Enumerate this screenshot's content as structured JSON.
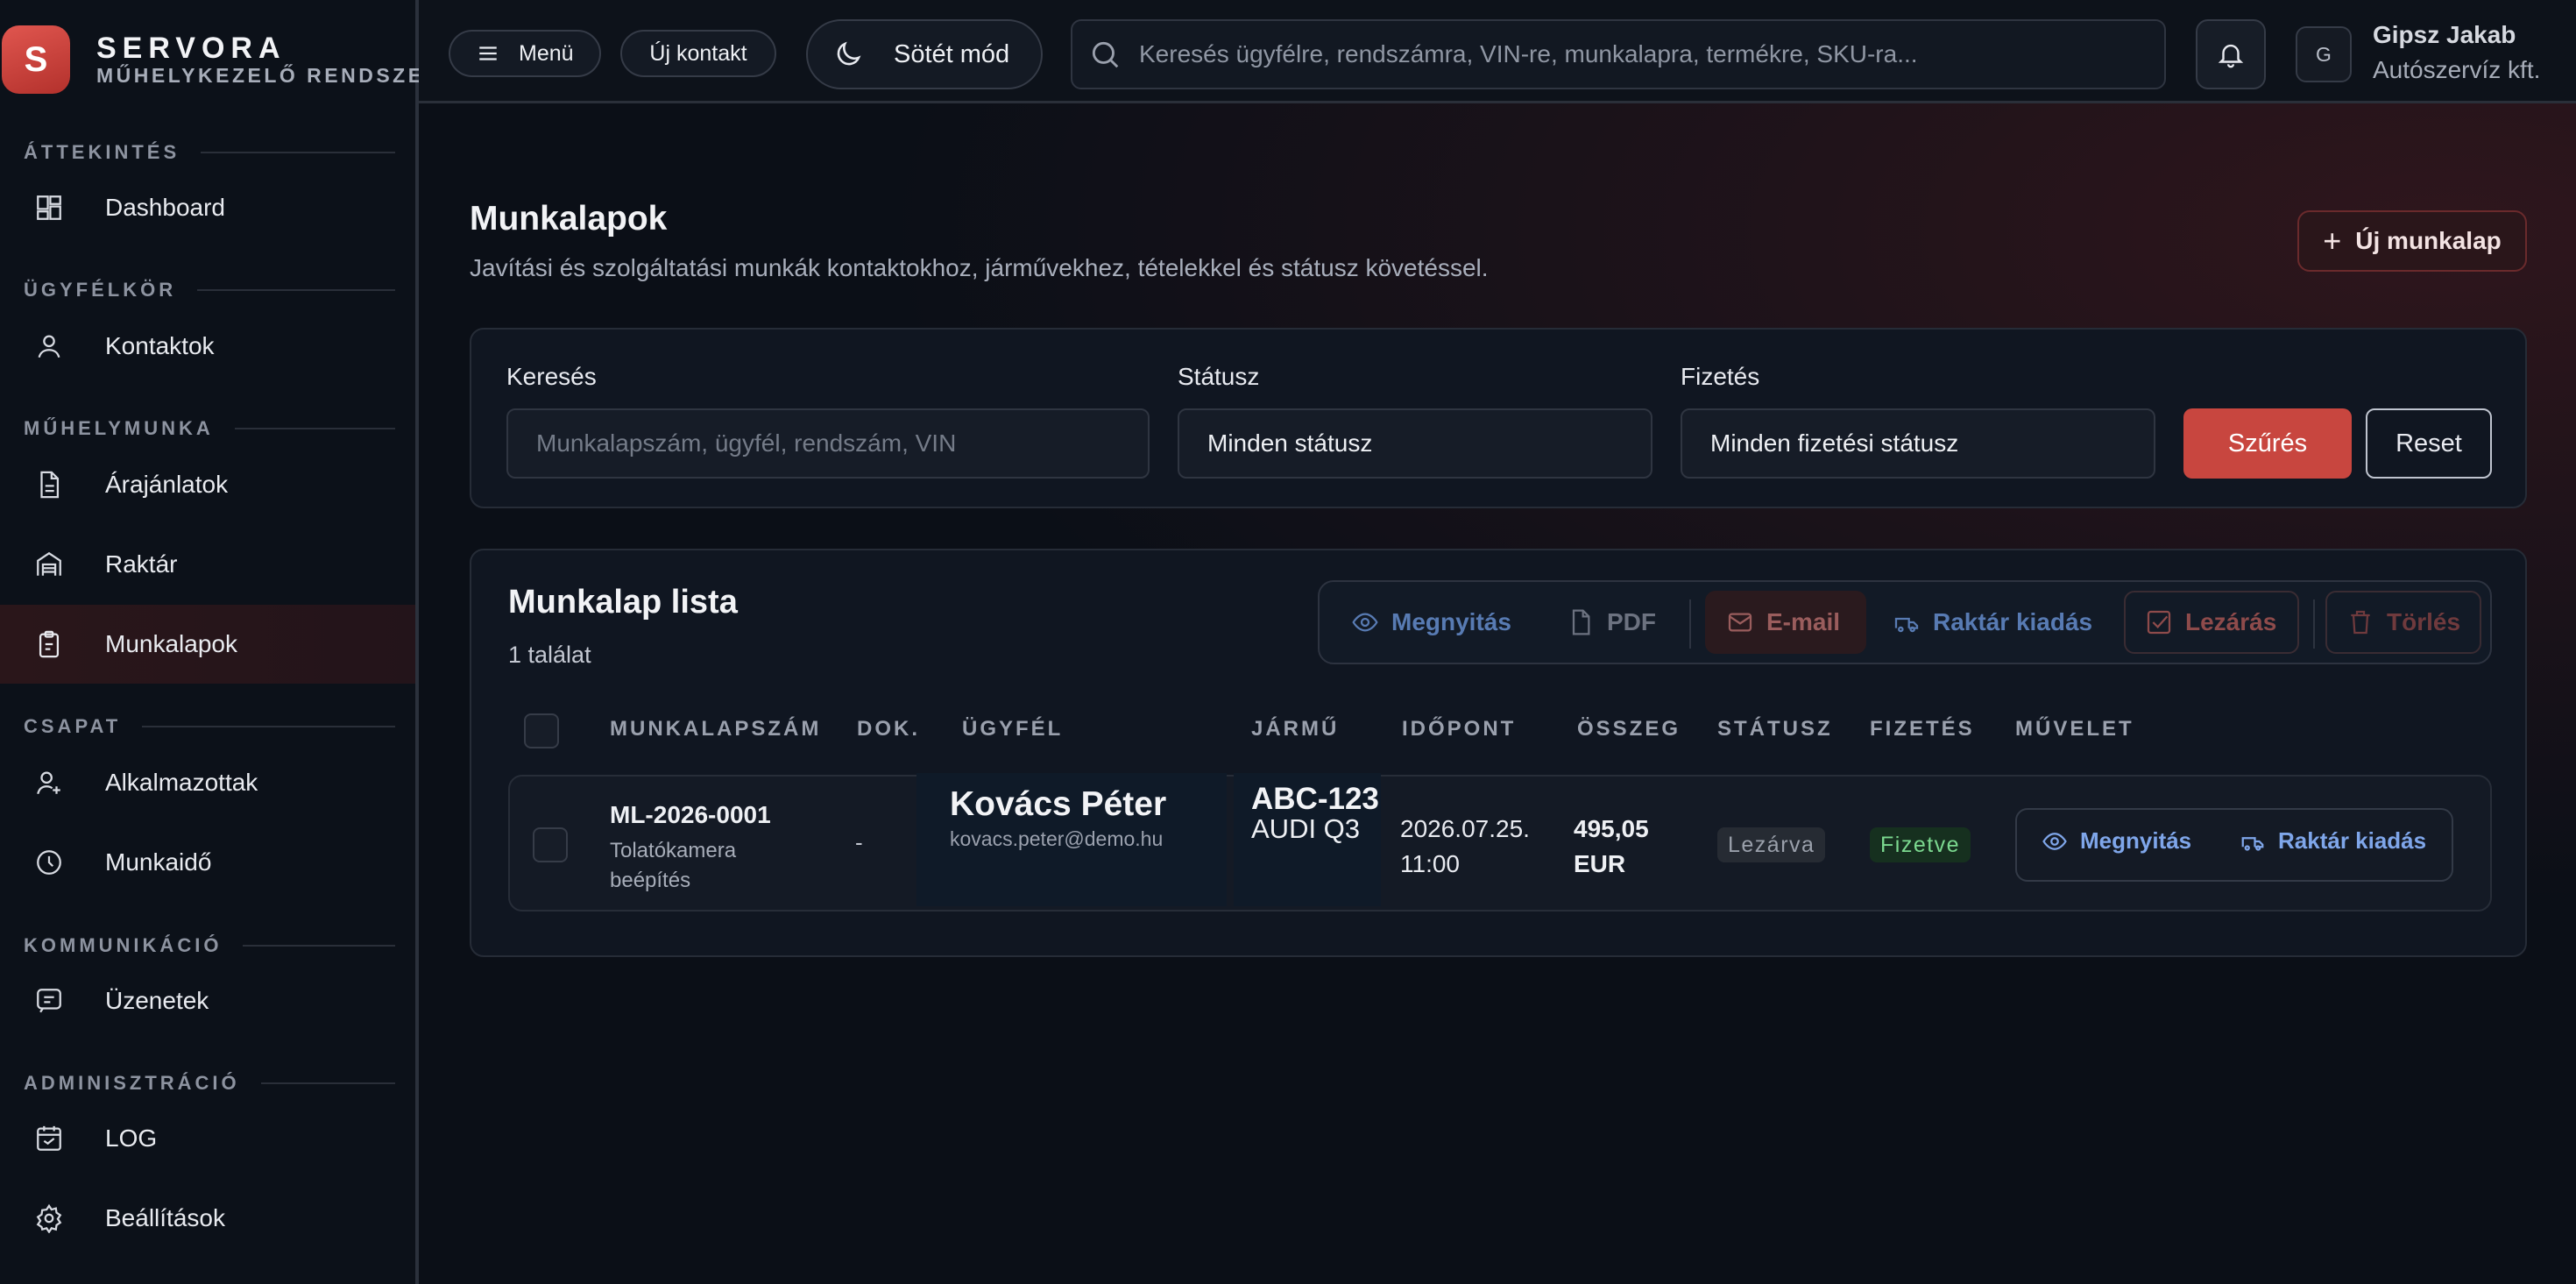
{
  "brand": {
    "logo_letter": "S",
    "name": "SERVORA",
    "subtitle": "MŰHELYKEZELŐ RENDSZER"
  },
  "sidebar": {
    "sections": [
      {
        "title": "ÁTTEKINTÉS",
        "items": [
          {
            "label": "Dashboard",
            "icon": "dashboard-icon"
          }
        ]
      },
      {
        "title": "ÜGYFÉLKÖR",
        "items": [
          {
            "label": "Kontaktok",
            "icon": "user-icon"
          }
        ]
      },
      {
        "title": "MŰHELYMUNKA",
        "items": [
          {
            "label": "Árajánlatok",
            "icon": "document-icon"
          },
          {
            "label": "Raktár",
            "icon": "warehouse-icon"
          },
          {
            "label": "Munkalapok",
            "icon": "clipboard-icon",
            "active": true
          }
        ]
      },
      {
        "title": "CSAPAT",
        "items": [
          {
            "label": "Alkalmazottak",
            "icon": "user-add-icon"
          },
          {
            "label": "Munkaidő",
            "icon": "clock-icon"
          }
        ]
      },
      {
        "title": "KOMMUNIKÁCIÓ",
        "items": [
          {
            "label": "Üzenetek",
            "icon": "message-icon"
          }
        ]
      },
      {
        "title": "ADMINISZTRÁCIÓ",
        "items": [
          {
            "label": "LOG",
            "icon": "calendar-log-icon"
          },
          {
            "label": "Beállítások",
            "icon": "gear-icon"
          }
        ]
      }
    ]
  },
  "topbar": {
    "menu_label": "Menü",
    "new_contact_label": "Új kontakt",
    "dark_mode_label": "Sötét mód",
    "search_placeholder": "Keresés ügyfélre, rendszámra, VIN-re, munkalapra, termékre, SKU-ra...",
    "user_initial": "G",
    "user_name": "Gipsz Jakab",
    "user_company": "Autószervíz kft."
  },
  "page": {
    "title": "Munkalapok",
    "subtitle": "Javítási és szolgáltatási munkák kontaktokhoz, járművekhez, tételekkel és státusz követéssel.",
    "new_button": "Új munkalap"
  },
  "filters": {
    "search_label": "Keresés",
    "search_placeholder": "Munkalapszám, ügyfél, rendszám, VIN",
    "status_label": "Státusz",
    "status_value": "Minden státusz",
    "payment_label": "Fizetés",
    "payment_value": "Minden fizetési státusz",
    "filter_button": "Szűrés",
    "reset_button": "Reset"
  },
  "list": {
    "title": "Munkalap lista",
    "count": "1 találat",
    "toolbar": {
      "open": "Megnyitás",
      "pdf": "PDF",
      "email": "E-mail",
      "stock_issue": "Raktár kiadás",
      "close": "Lezárás",
      "delete": "Törlés"
    },
    "columns": [
      "MUNKALAPSZÁM",
      "DOK.",
      "ÜGYFÉL",
      "JÁRMŰ",
      "IDŐPONT",
      "ÖSSZEG",
      "STÁTUSZ",
      "FIZETÉS",
      "MŰVELET"
    ],
    "rows": [
      {
        "number": "ML-2026-0001",
        "description": "Tolatókamera beépítés",
        "doc": "-",
        "customer_name": "Kovács Péter",
        "customer_email": "kovacs.peter@demo.hu",
        "vehicle_plate": "ABC-123",
        "vehicle_model": "AUDI Q3",
        "date": "2026.07.25.",
        "time": "11:00",
        "amount": "495,05",
        "currency": "EUR",
        "status": "Lezárva",
        "payment": "Fizetve",
        "action_open": "Megnyitás",
        "action_stock": "Raktár kiadás"
      }
    ]
  },
  "colors": {
    "accent_red": "#c8463f",
    "link_blue": "#7fa6ea",
    "paid_green": "#7bd88f",
    "background": "#0b0f17"
  }
}
